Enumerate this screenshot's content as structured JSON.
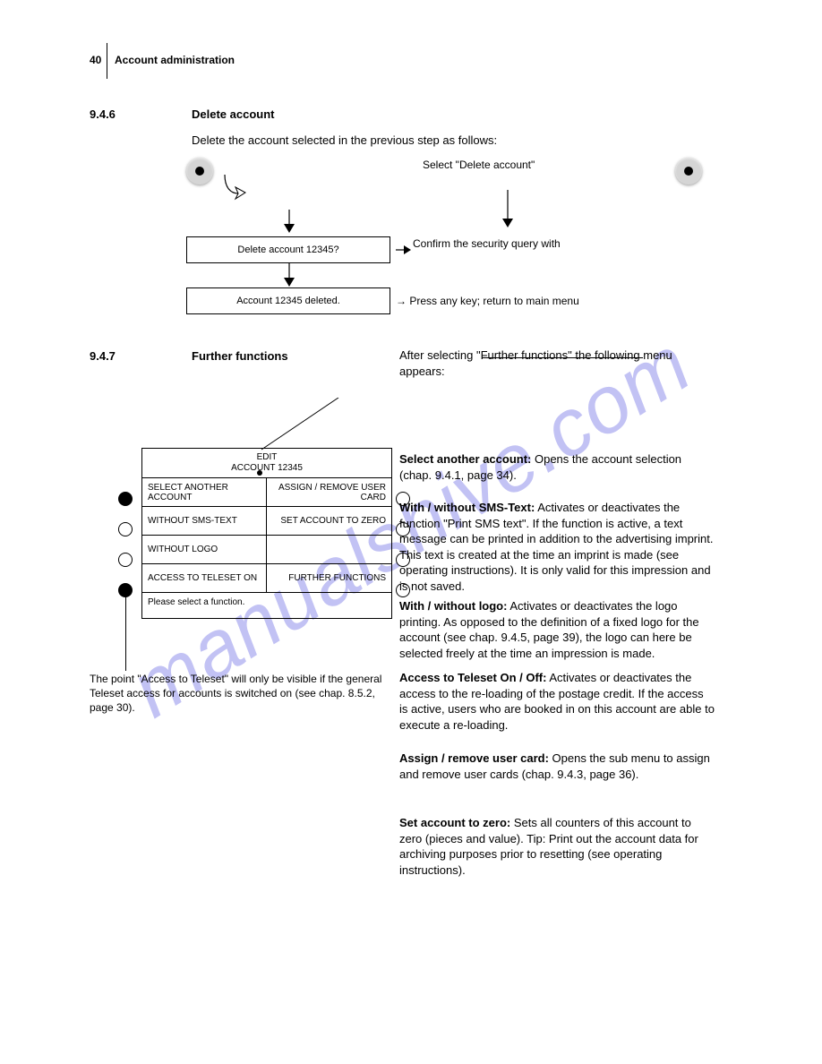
{
  "header": {
    "page_number": "40",
    "title": "Account administration"
  },
  "section1": {
    "number": "9.4.6",
    "title": "Delete account",
    "intro": "Delete the account selected in the previous step as follows:",
    "flow": {
      "radio_label": "Select \"Delete account\"",
      "box1": "Delete account 12345?",
      "box2": "Account 12345 deleted.",
      "right1": "Confirm the security query with",
      "right3": "Press any key",
      "main_menu": "; return to main menu"
    }
  },
  "section2": {
    "number": "9.4.7",
    "title": "Further functions",
    "lead": "After selecting \"Further functions\" the following menu appears:",
    "acct_header_line1": "EDIT",
    "acct_header_line2": "ACCOUNT 12345",
    "rows": [
      {
        "left": "SELECT ANOTHER ACCOUNT",
        "right": "ASSIGN / REMOVE USER CARD",
        "leftFilled": true,
        "rightFilled": false
      },
      {
        "left": "WITHOUT SMS-TEXT",
        "right": "SET ACCOUNT TO ZERO",
        "leftFilled": false,
        "rightFilled": false
      },
      {
        "left": "WITHOUT LOGO",
        "right": "",
        "leftFilled": false,
        "rightFilled": false
      },
      {
        "left": "ACCESS TO TELESET ON",
        "right": "FURTHER FUNCTIONS",
        "leftFilled": true,
        "rightFilled": false
      }
    ],
    "footer": "Please select a function.",
    "right_blocks": {
      "block1_head": "Select another account:",
      "block1_body": " Opens the account selection (chap. 9.4.1, page 34).",
      "block2_head": "With / without SMS-Text:",
      "block2_body": " Activates or deactivates the function \"Print SMS text\". If the function is active, a text message can be printed in addition to the advertising imprint. This text is created at the time an imprint is made (see operating instructions). It is only valid for this impression and is not saved.",
      "block3_head": "With / without logo:",
      "block3_body": " Activates or deactivates the logo printing. As opposed to the definition of a fixed logo for the account (see chap. 9.4.5, page 39), the logo can here be selected freely at the time an impression is made.",
      "block4_head": "Access to Teleset On / Off:",
      "block4_body": " Activates or deactivates the access to the re-loading of the postage credit. If the access is active, users who are booked in on this account are able to execute a re-loading.",
      "block5_head": "Assign / remove user card:",
      "block5_body": " Opens the sub menu to assign and remove user cards (chap. 9.4.3, page 36).",
      "block6_head": "Set account to zero:",
      "block6_body": " Sets all counters of this account to zero (pieces and value). Tip: Print out the account data for archiving purposes prior to resetting (see operating instructions)."
    },
    "teleset_para": "The point \"Access to Teleset\" will only be visible if the general Teleset access for accounts is switched on (see chap. 8.5.2, page 30)."
  }
}
